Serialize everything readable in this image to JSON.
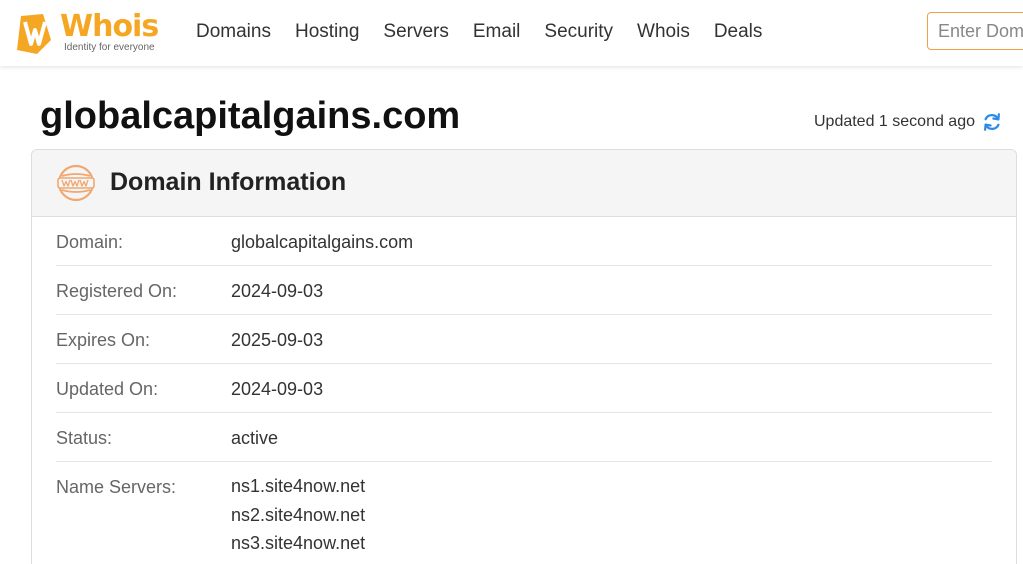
{
  "logo": {
    "name": "Whois",
    "tagline": "Identity for everyone"
  },
  "nav": {
    "items": [
      "Domains",
      "Hosting",
      "Servers",
      "Email",
      "Security",
      "Whois",
      "Deals"
    ]
  },
  "search": {
    "placeholder": "Enter Domain"
  },
  "page": {
    "domain": "globalcapitalgains.com",
    "updated": "Updated 1 second ago"
  },
  "card": {
    "title": "Domain Information",
    "rows": [
      {
        "label": "Domain:",
        "value": "globalcapitalgains.com"
      },
      {
        "label": "Registered On:",
        "value": "2024-09-03"
      },
      {
        "label": "Expires On:",
        "value": "2025-09-03"
      },
      {
        "label": "Updated On:",
        "value": "2024-09-03"
      },
      {
        "label": "Status:",
        "value": "active"
      }
    ],
    "name_servers": {
      "label": "Name Servers:",
      "values": [
        "ns1.site4now.net",
        "ns2.site4now.net",
        "ns3.site4now.net"
      ]
    }
  },
  "colors": {
    "brand": "#f5a623",
    "refresh": "#2a8ce6",
    "icon": "#f0a870"
  },
  "icons": {
    "logo": "whois-logo-icon",
    "refresh": "refresh-icon",
    "www": "www-globe-icon"
  }
}
